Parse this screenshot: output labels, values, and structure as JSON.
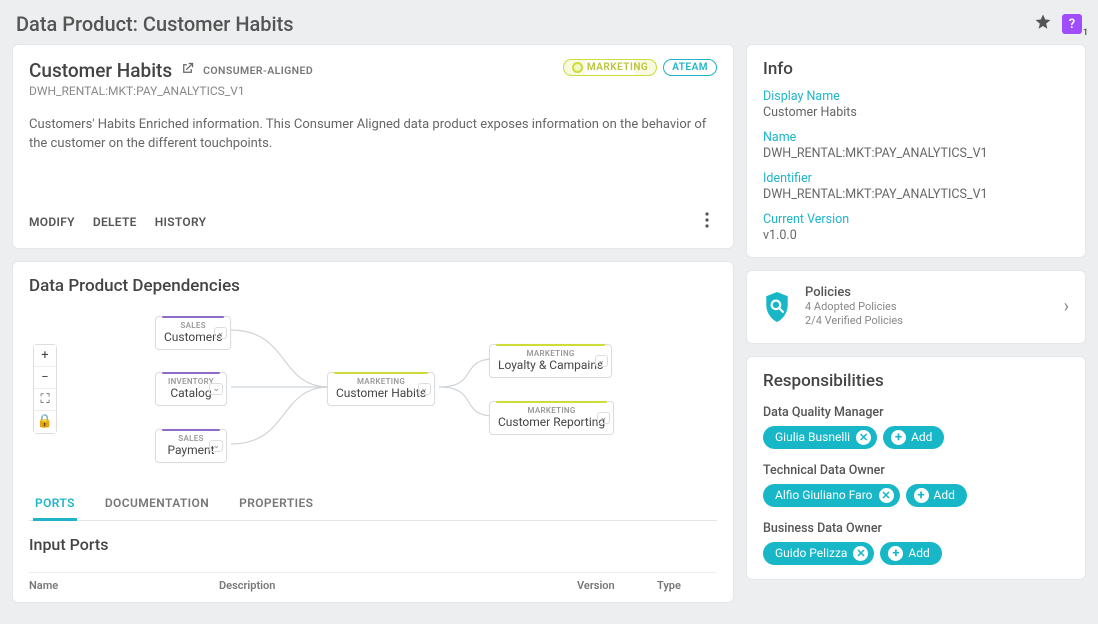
{
  "page": {
    "title": "Data Product: Customer Habits"
  },
  "summary": {
    "title": "Customer Habits",
    "alignment": "CONSUMER-ALIGNED",
    "code": "DWH_RENTAL:MKT:PAY_ANALYTICS_V1",
    "description": "Customers' Habits Enriched information. This Consumer Aligned data product exposes information on the behavior of the customer on the different touchpoints.",
    "domain_chip": "MARKETING",
    "team_chip": "ATEAM",
    "actions": {
      "modify": "MODIFY",
      "delete": "DELETE",
      "history": "HISTORY"
    }
  },
  "dependencies": {
    "title": "Data Product Dependencies",
    "nodes": {
      "customers": {
        "domain": "SALES",
        "name": "Customers"
      },
      "catalog": {
        "domain": "INVENTORY",
        "name": "Catalog"
      },
      "payment": {
        "domain": "SALES",
        "name": "Payment"
      },
      "habits": {
        "domain": "MARKETING",
        "name": "Customer Habits"
      },
      "loyalty": {
        "domain": "MARKETING",
        "name": "Loyalty & Campains"
      },
      "reporting": {
        "domain": "MARKETING",
        "name": "Customer Reporting"
      }
    }
  },
  "tabs": {
    "ports": "PORTS",
    "documentation": "DOCUMENTATION",
    "properties": "PROPERTIES"
  },
  "ports": {
    "title": "Input Ports",
    "columns": {
      "name": "Name",
      "description": "Description",
      "version": "Version",
      "type": "Type"
    }
  },
  "info": {
    "title": "Info",
    "display_name_label": "Display Name",
    "display_name": "Customer Habits",
    "name_label": "Name",
    "name": "DWH_RENTAL:MKT:PAY_ANALYTICS_V1",
    "identifier_label": "Identifier",
    "identifier": "DWH_RENTAL:MKT:PAY_ANALYTICS_V1",
    "version_label": "Current Version",
    "version": "v1.0.0"
  },
  "policies": {
    "title": "Policies",
    "adopted": "4 Adopted Policies",
    "verified": "2/4 Verified Policies"
  },
  "responsibilities": {
    "title": "Responsibilities",
    "roles": [
      {
        "label": "Data Quality Manager",
        "person": "Giulia Busnelli"
      },
      {
        "label": "Technical Data Owner",
        "person": "Alfio Giuliano Faro"
      },
      {
        "label": "Business Data Owner",
        "person": "Guido Pelizza"
      }
    ],
    "add_label": "Add"
  }
}
